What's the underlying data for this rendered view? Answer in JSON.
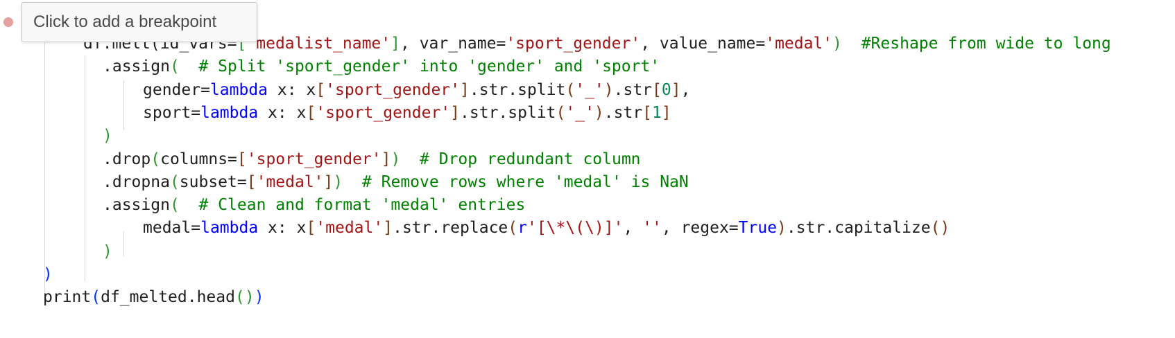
{
  "tooltip": {
    "text": "Click to add a breakpoint"
  },
  "lines": [
    {
      "indent": 120,
      "tokens": [
        {
          "t": "df.melt(id_vars=",
          "c": ""
        },
        {
          "t": "[",
          "c": "p2"
        },
        {
          "t": "'medalist_name'",
          "c": "str"
        },
        {
          "t": "]",
          "c": "p2"
        },
        {
          "t": ", var_name=",
          "c": ""
        },
        {
          "t": "'sport_gender'",
          "c": "str"
        },
        {
          "t": ", value_name=",
          "c": ""
        },
        {
          "t": "'medal'",
          "c": "str"
        },
        {
          "t": ")",
          "c": "p2"
        },
        {
          "t": "  #Reshape from wide to long",
          "c": "com"
        }
      ]
    },
    {
      "indent": 148,
      "tokens": [
        {
          "t": ".assign",
          "c": ""
        },
        {
          "t": "(",
          "c": "p2"
        },
        {
          "t": "  # Split 'sport_gender' into 'gender' and 'sport'",
          "c": "com"
        }
      ]
    },
    {
      "indent": 206,
      "tokens": [
        {
          "t": "gender=",
          "c": ""
        },
        {
          "t": "lambda",
          "c": "kw"
        },
        {
          "t": " x: x",
          "c": ""
        },
        {
          "t": "[",
          "c": "p3"
        },
        {
          "t": "'sport_gender'",
          "c": "str"
        },
        {
          "t": "]",
          "c": "p3"
        },
        {
          "t": ".str.split",
          "c": ""
        },
        {
          "t": "(",
          "c": "p3"
        },
        {
          "t": "'_'",
          "c": "str"
        },
        {
          "t": ")",
          "c": "p3"
        },
        {
          "t": ".str",
          "c": ""
        },
        {
          "t": "[",
          "c": "p3"
        },
        {
          "t": "0",
          "c": "num"
        },
        {
          "t": "]",
          "c": "p3"
        },
        {
          "t": ",",
          "c": ""
        }
      ]
    },
    {
      "indent": 206,
      "tokens": [
        {
          "t": "sport=",
          "c": ""
        },
        {
          "t": "lambda",
          "c": "kw"
        },
        {
          "t": " x: x",
          "c": ""
        },
        {
          "t": "[",
          "c": "p3"
        },
        {
          "t": "'sport_gender'",
          "c": "str"
        },
        {
          "t": "]",
          "c": "p3"
        },
        {
          "t": ".str.split",
          "c": ""
        },
        {
          "t": "(",
          "c": "p3"
        },
        {
          "t": "'_'",
          "c": "str"
        },
        {
          "t": ")",
          "c": "p3"
        },
        {
          "t": ".str",
          "c": ""
        },
        {
          "t": "[",
          "c": "p3"
        },
        {
          "t": "1",
          "c": "num"
        },
        {
          "t": "]",
          "c": "p3"
        }
      ]
    },
    {
      "indent": 148,
      "tokens": [
        {
          "t": ")",
          "c": "p2"
        }
      ]
    },
    {
      "indent": 148,
      "tokens": [
        {
          "t": ".drop",
          "c": ""
        },
        {
          "t": "(",
          "c": "p2"
        },
        {
          "t": "columns=",
          "c": ""
        },
        {
          "t": "[",
          "c": "p3"
        },
        {
          "t": "'sport_gender'",
          "c": "str"
        },
        {
          "t": "]",
          "c": "p3"
        },
        {
          "t": ")",
          "c": "p2"
        },
        {
          "t": "  # Drop redundant column",
          "c": "com"
        }
      ]
    },
    {
      "indent": 148,
      "tokens": [
        {
          "t": ".dropna",
          "c": ""
        },
        {
          "t": "(",
          "c": "p2"
        },
        {
          "t": "subset=",
          "c": ""
        },
        {
          "t": "[",
          "c": "p3"
        },
        {
          "t": "'medal'",
          "c": "str"
        },
        {
          "t": "]",
          "c": "p3"
        },
        {
          "t": ")",
          "c": "p2"
        },
        {
          "t": "  # Remove rows where 'medal' is NaN",
          "c": "com"
        }
      ]
    },
    {
      "indent": 148,
      "tokens": [
        {
          "t": ".assign",
          "c": ""
        },
        {
          "t": "(",
          "c": "p2"
        },
        {
          "t": "  # Clean and format 'medal' entries",
          "c": "com"
        }
      ]
    },
    {
      "indent": 206,
      "tokens": [
        {
          "t": "medal=",
          "c": ""
        },
        {
          "t": "lambda",
          "c": "kw"
        },
        {
          "t": " x: x",
          "c": ""
        },
        {
          "t": "[",
          "c": "p3"
        },
        {
          "t": "'medal'",
          "c": "str"
        },
        {
          "t": "]",
          "c": "p3"
        },
        {
          "t": ".str.replace",
          "c": ""
        },
        {
          "t": "(",
          "c": "p3"
        },
        {
          "t": "r",
          "c": "kw"
        },
        {
          "t": "'[\\*\\(\\)]'",
          "c": "str"
        },
        {
          "t": ", ",
          "c": ""
        },
        {
          "t": "''",
          "c": "str"
        },
        {
          "t": ", regex=",
          "c": ""
        },
        {
          "t": "True",
          "c": "kw"
        },
        {
          "t": ")",
          "c": "p3"
        },
        {
          "t": ".str.capitalize",
          "c": ""
        },
        {
          "t": "()",
          "c": "p3"
        }
      ]
    },
    {
      "indent": 148,
      "tokens": [
        {
          "t": ")",
          "c": "p2"
        }
      ]
    },
    {
      "indent": 62,
      "tokens": [
        {
          "t": ")",
          "c": "p1"
        }
      ]
    },
    {
      "indent": 62,
      "tokens": [
        {
          "t": "print",
          "c": ""
        },
        {
          "t": "(",
          "c": "p1"
        },
        {
          "t": "df_melted.head",
          "c": ""
        },
        {
          "t": "()",
          "c": "p2"
        },
        {
          "t": ")",
          "c": "p1"
        }
      ]
    }
  ]
}
